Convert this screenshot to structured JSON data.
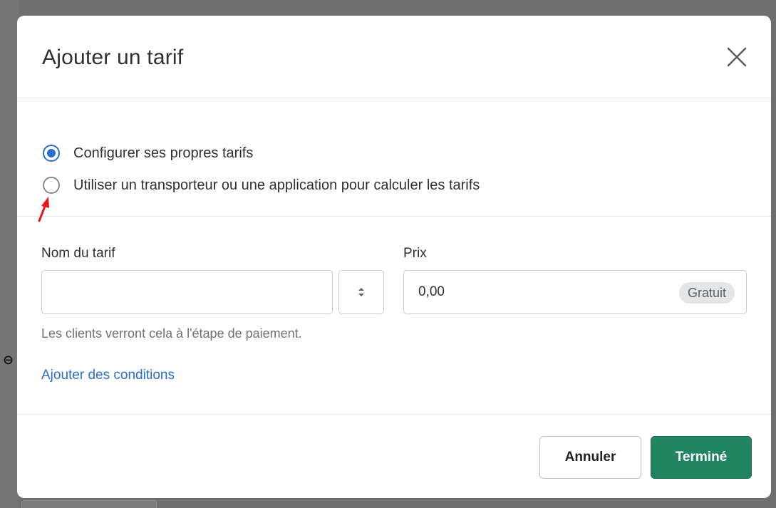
{
  "modal": {
    "title": "Ajouter un tarif",
    "close_icon": "close-icon"
  },
  "rate_options": [
    {
      "label": "Configurer ses propres tarifs",
      "checked": true
    },
    {
      "label": "Utiliser un transporteur ou une application pour calculer les tarifs",
      "checked": false
    }
  ],
  "form": {
    "rate_name_label": "Nom du tarif",
    "rate_name_value": "",
    "price_label": "Prix",
    "price_value": "0,00",
    "price_badge": "Gratuit",
    "help_text": "Les clients verront cela à l'étape de paiement.",
    "add_conditions_link": "Ajouter des conditions"
  },
  "footer": {
    "cancel_label": "Annuler",
    "done_label": "Terminé"
  },
  "colors": {
    "accent_blue": "#2c6ecb",
    "primary_green": "#218561",
    "annotation_red": "#e8151b"
  }
}
